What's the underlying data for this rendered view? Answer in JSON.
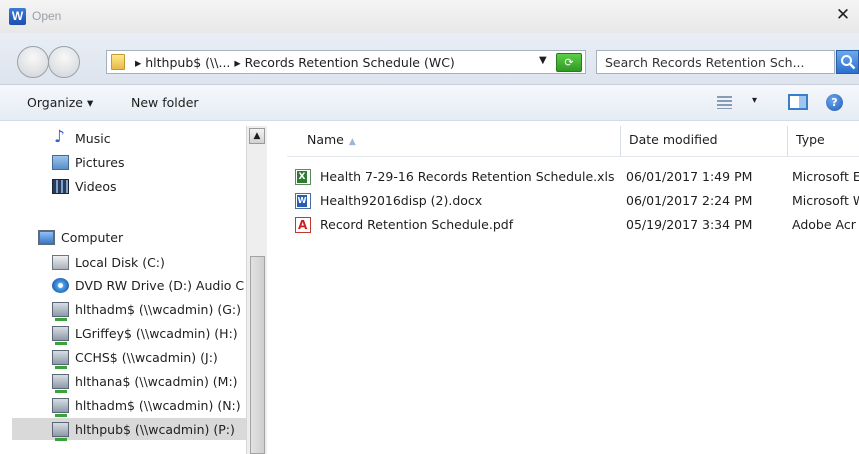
{
  "window": {
    "app_icon": "W",
    "title": "Open",
    "close_glyph": "✕"
  },
  "address": {
    "breadcrumb": "▸ hlthpub$ (\\\\...  ▸ Records Retention Schedule (WC)",
    "dropdown_glyph": "▼",
    "refresh_glyph": "⟳"
  },
  "search": {
    "placeholder": "Search Records Retention Sch..."
  },
  "toolbar": {
    "organize_label": "Organize ▾",
    "new_folder_label": "New folder",
    "views_dropdown_glyph": "▾",
    "help_glyph": "?"
  },
  "nav": {
    "scroll_up_glyph": "▲",
    "items": [
      {
        "label": "Music",
        "icon": "music-icon"
      },
      {
        "label": "Pictures",
        "icon": "pictures-icon"
      },
      {
        "label": "Videos",
        "icon": "videos-icon"
      },
      {
        "label": "Computer",
        "icon": "computer-icon"
      },
      {
        "label": "Local Disk (C:)",
        "icon": "local-disk-icon"
      },
      {
        "label": "DVD RW Drive (D:) Audio C",
        "icon": "dvd-drive-icon"
      },
      {
        "label": "hlthadm$ (\\\\wcadmin) (G:)",
        "icon": "network-drive-icon"
      },
      {
        "label": "LGriffey$ (\\\\wcadmin) (H:)",
        "icon": "network-drive-icon"
      },
      {
        "label": "CCHS$ (\\\\wcadmin) (J:)",
        "icon": "network-drive-icon"
      },
      {
        "label": "hlthana$ (\\\\wcadmin) (M:)",
        "icon": "network-drive-icon"
      },
      {
        "label": "hlthadm$ (\\\\wcadmin) (N:)",
        "icon": "network-drive-icon"
      },
      {
        "label": "hlthpub$ (\\\\wcadmin) (P:)",
        "icon": "network-drive-icon",
        "selected": true
      }
    ]
  },
  "files": {
    "columns": {
      "name": "Name",
      "sort_glyph": "▲",
      "date": "Date modified",
      "type": "Type"
    },
    "rows": [
      {
        "name": "Health 7-29-16 Records Retention Schedule.xls",
        "date": "06/01/2017 1:49 PM",
        "type": "Microsoft E",
        "icon": "excel-file-icon"
      },
      {
        "name": "Health92016disp (2).docx",
        "date": "06/01/2017 2:24 PM",
        "type": "Microsoft W",
        "icon": "word-file-icon"
      },
      {
        "name": "Record Retention Schedule.pdf",
        "date": "05/19/2017 3:34 PM",
        "type": "Adobe Acr",
        "icon": "pdf-file-icon"
      }
    ]
  }
}
